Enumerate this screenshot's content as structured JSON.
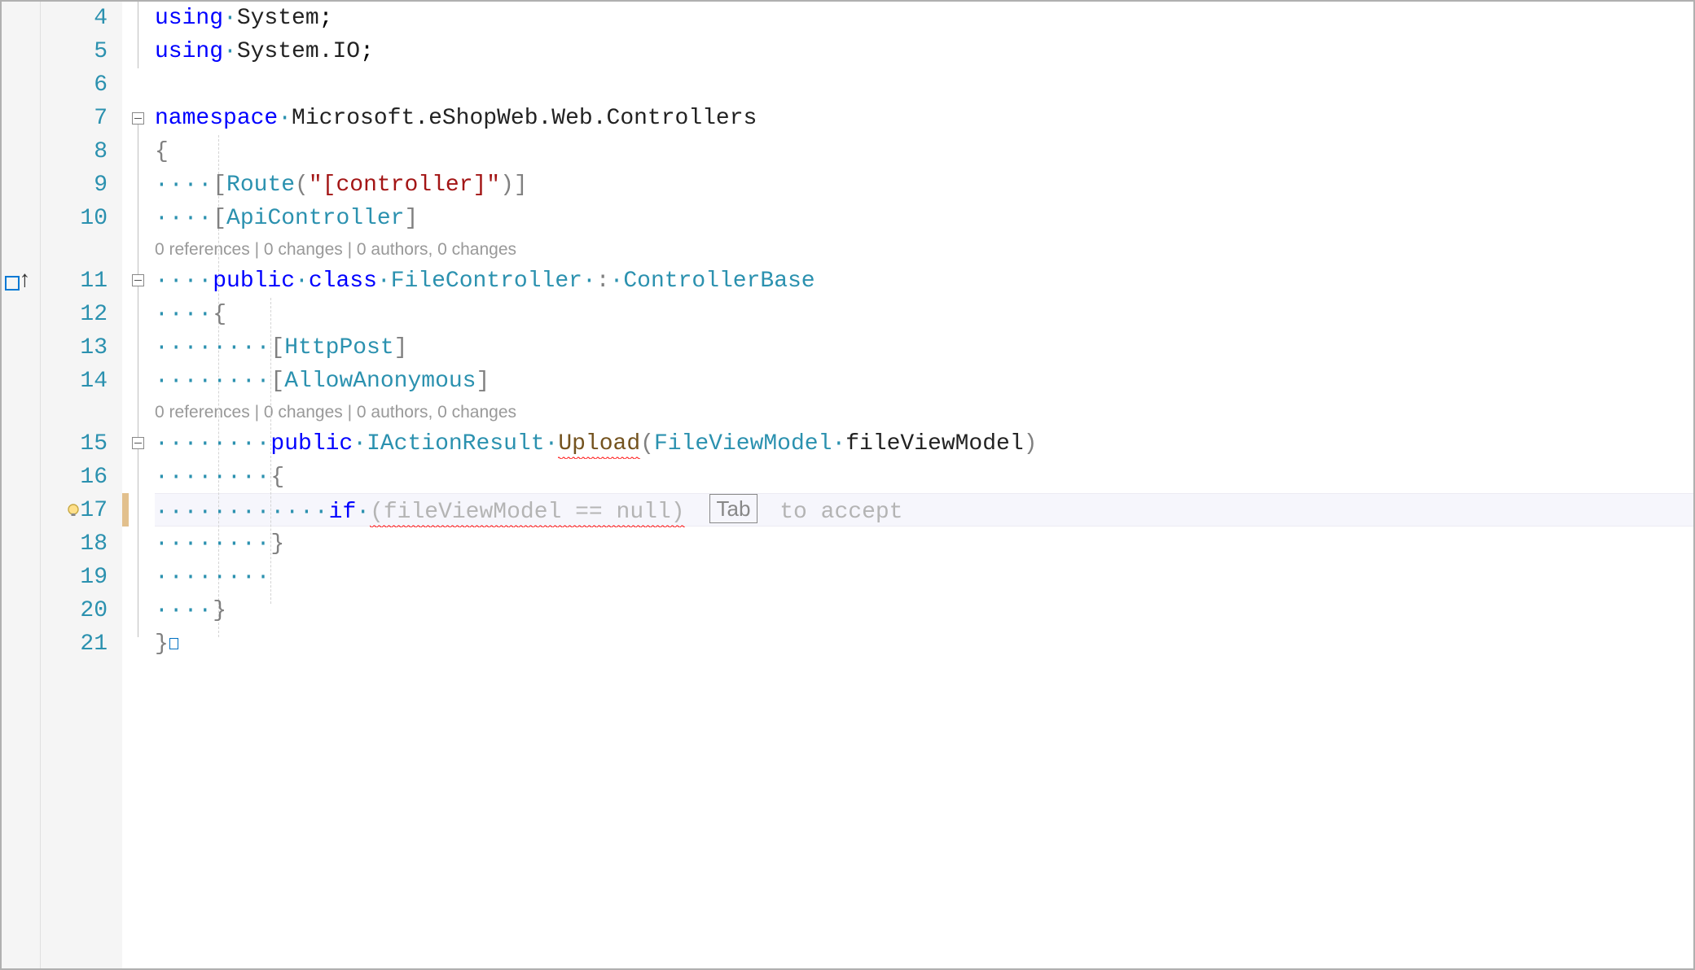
{
  "lineNumbers": {
    "l4": "4",
    "l5": "5",
    "l6": "6",
    "l7": "7",
    "l8": "8",
    "l9": "9",
    "l10": "10",
    "l11": "11",
    "l12": "12",
    "l13": "13",
    "l14": "14",
    "l15": "15",
    "l16": "16",
    "l17": "17",
    "l18": "18",
    "l19": "19",
    "l20": "20",
    "l21": "21"
  },
  "tokens": {
    "using": "using",
    "namespace": "namespace",
    "public": "public",
    "class": "class",
    "if": "if",
    "System": "System",
    "SystemIO": "System.IO",
    "nsFull": "Microsoft.eShopWeb.Web.Controllers",
    "Route": "Route",
    "controllerLit": "\"[controller]\"",
    "ApiController": "ApiController",
    "HttpPost": "HttpPost",
    "AllowAnonymous": "AllowAnonymous",
    "FileController": "FileController",
    "ControllerBase": "ControllerBase",
    "IActionResult": "IActionResult",
    "Upload": "Upload",
    "FileViewModel": "FileViewModel",
    "paramName": "fileViewModel",
    "suggestion": "(fileViewModel == null)",
    "openBrace": "{",
    "closeBrace": "}",
    "semi": ";",
    "colon": ":",
    "openParen": "(",
    "closeParen": ")",
    "openBracket": "[",
    "closeBracket": "]"
  },
  "codelens": {
    "classLine": "0 references | 0 changes | 0 authors, 0 changes",
    "methodLine": "0 references | 0 changes | 0 authors, 0 changes"
  },
  "hint": {
    "tabKey": "Tab",
    "toAccept": " to accept"
  },
  "whitespace": {
    "dot": "·",
    "d4": "····",
    "d8": "········",
    "d12": "············"
  }
}
